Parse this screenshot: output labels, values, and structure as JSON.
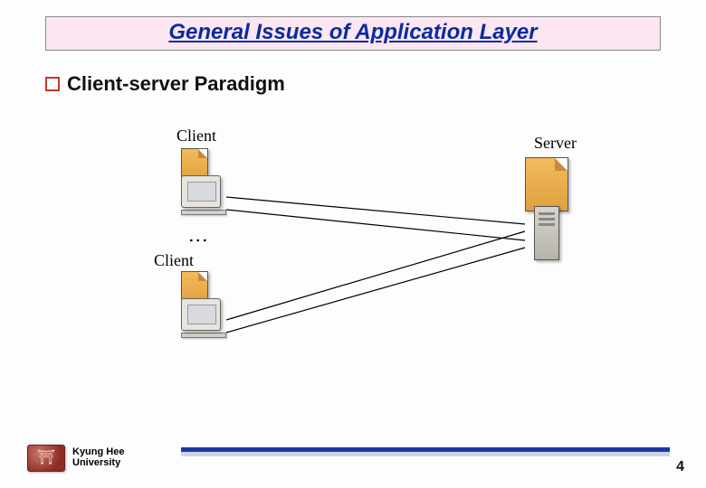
{
  "title": "General Issues of Application Layer",
  "bullet": "Client-server Paradigm",
  "diagram": {
    "client_label_top": "Client",
    "client_label_bottom": "Client",
    "server_label": "Server"
  },
  "footer": {
    "org_line1": "Kyung Hee",
    "org_line2": "University"
  },
  "page_number": "4"
}
